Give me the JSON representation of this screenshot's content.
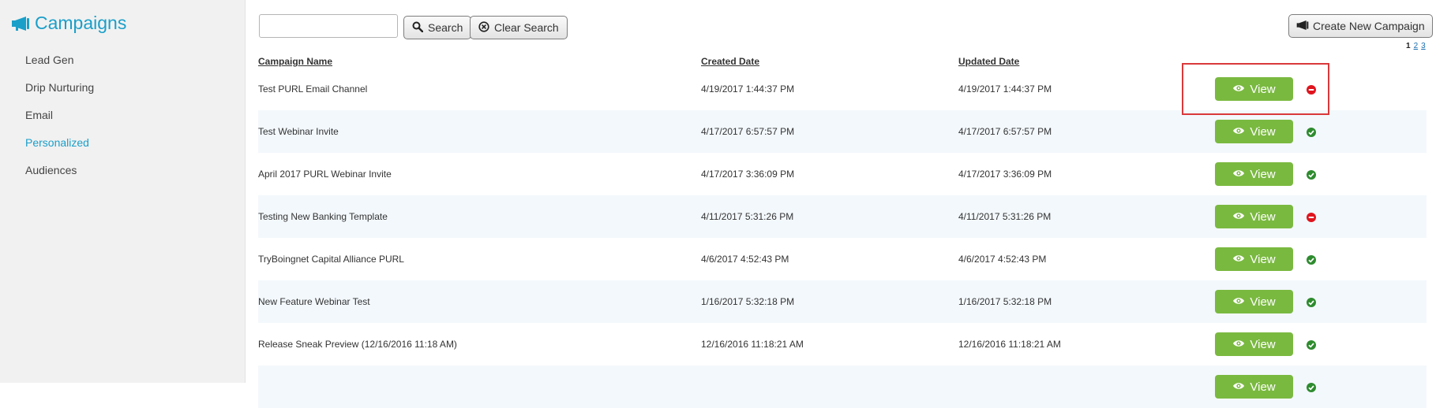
{
  "sidebar": {
    "title": "Campaigns",
    "title_icon": "megaphone-icon",
    "items": [
      {
        "label": "Lead Gen",
        "active": false
      },
      {
        "label": "Drip Nurturing",
        "active": false
      },
      {
        "label": "Email",
        "active": false
      },
      {
        "label": "Personalized",
        "active": true
      },
      {
        "label": "Audiences",
        "active": false
      }
    ]
  },
  "toolbar": {
    "search_value": "",
    "search_placeholder": "",
    "search_label": "Search",
    "clear_label": "Clear Search",
    "create_label": "Create New Campaign"
  },
  "pagination": {
    "current": "1",
    "pages": [
      "2",
      "3"
    ]
  },
  "table": {
    "headers": {
      "name": "Campaign Name",
      "created": "Created Date",
      "updated": "Updated Date"
    },
    "view_label": "View",
    "rows": [
      {
        "name": "Test PURL Email Channel",
        "created": "4/19/2017 1:44:37 PM",
        "updated": "4/19/2017 1:44:37 PM",
        "status": "inactive"
      },
      {
        "name": "Test Webinar Invite",
        "created": "4/17/2017 6:57:57 PM",
        "updated": "4/17/2017 6:57:57 PM",
        "status": "active"
      },
      {
        "name": "April 2017 PURL Webinar Invite",
        "created": "4/17/2017 3:36:09 PM",
        "updated": "4/17/2017 3:36:09 PM",
        "status": "active"
      },
      {
        "name": "Testing New Banking Template",
        "created": "4/11/2017 5:31:26 PM",
        "updated": "4/11/2017 5:31:26 PM",
        "status": "inactive"
      },
      {
        "name": "TryBoingnet Capital Alliance PURL",
        "created": "4/6/2017 4:52:43 PM",
        "updated": "4/6/2017 4:52:43 PM",
        "status": "active"
      },
      {
        "name": "New Feature Webinar Test",
        "created": "1/16/2017 5:32:18 PM",
        "updated": "1/16/2017 5:32:18 PM",
        "status": "active"
      },
      {
        "name": "Release Sneak Preview (12/16/2016 11:18 AM)",
        "created": "12/16/2016 11:18:21 AM",
        "updated": "12/16/2016 11:18:21 AM",
        "status": "active"
      },
      {
        "name": "",
        "created": "",
        "updated": "",
        "status": "active"
      }
    ]
  },
  "colors": {
    "accent": "#1a9fc9",
    "view_button": "#7ab940",
    "status_active": "#2e8b2e",
    "status_inactive": "#e0141e",
    "highlight_box": "#d9393b",
    "row_alt": "#f3f8fc"
  }
}
